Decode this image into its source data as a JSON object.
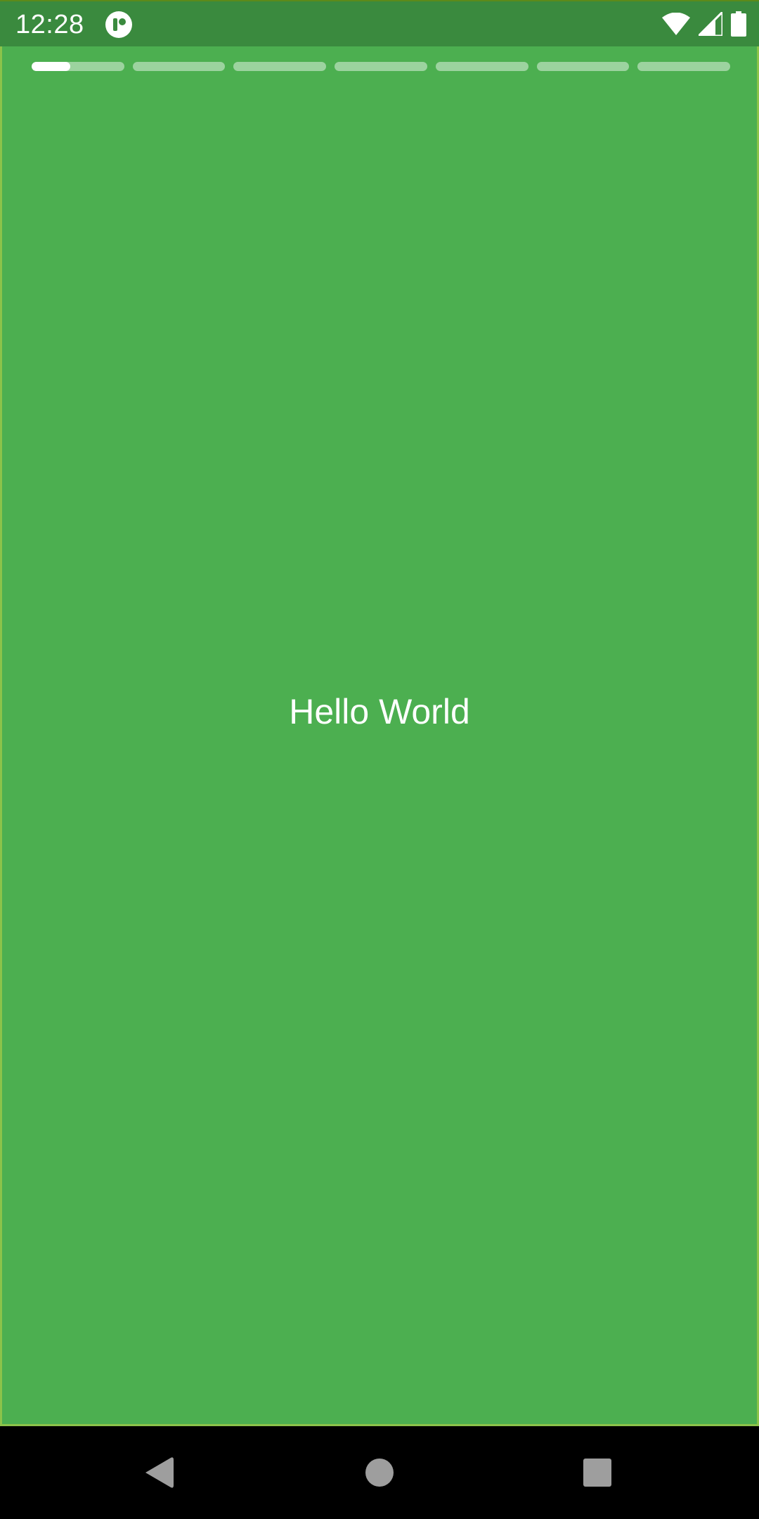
{
  "status_bar": {
    "time": "12:28",
    "icons": [
      "app-notification-icon",
      "wifi-icon",
      "cell-signal-icon",
      "battery-icon"
    ]
  },
  "story": {
    "text": "Hello World",
    "background_color": "#4caf50",
    "segment_count": 7,
    "active_segment": 1,
    "active_progress": 0.42
  },
  "nav_bar": {
    "buttons": [
      "back-icon",
      "home-icon",
      "recents-icon"
    ]
  },
  "colors": {
    "status_bar": "#3a8a3e",
    "story_background": "#4caf50",
    "border": "#8bc34a",
    "nav_bar": "#000000",
    "nav_icon": "#9e9e9e"
  }
}
